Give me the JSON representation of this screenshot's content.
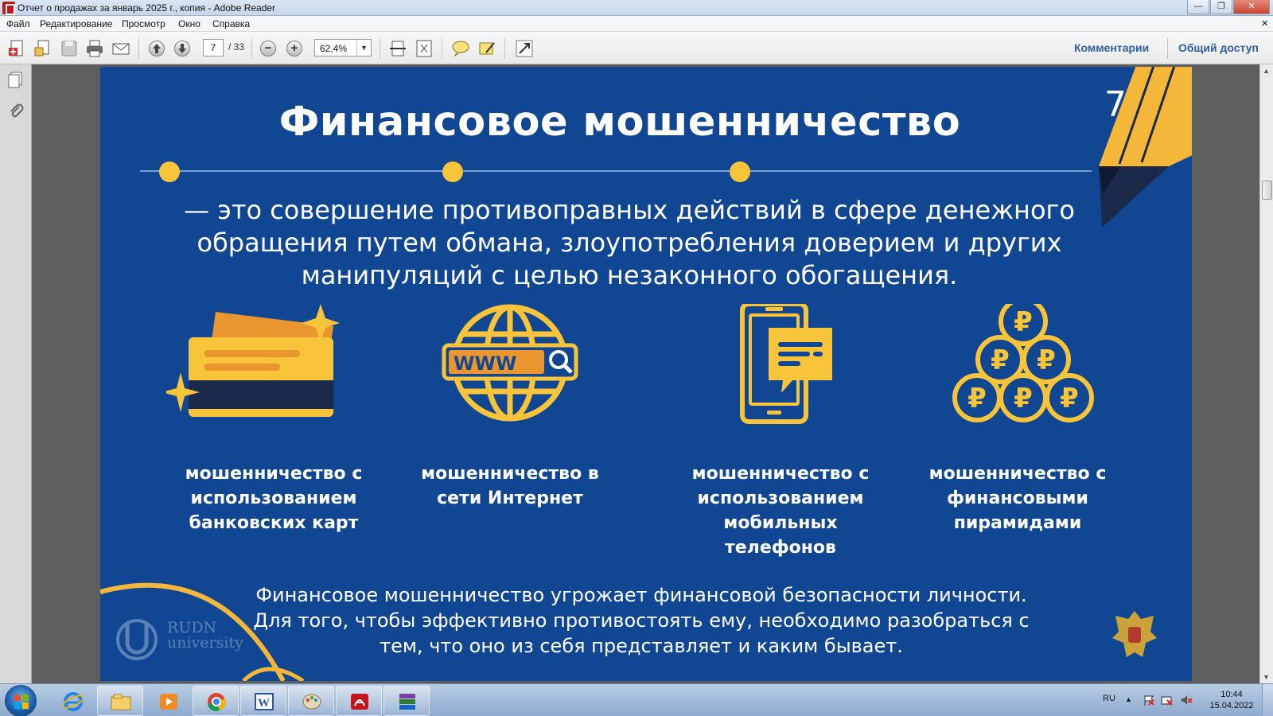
{
  "window": {
    "title": "Отчет о продажах за январь 2025 г., копия - Adobe Reader",
    "controls": {
      "minimize": "—",
      "maximize": "❐",
      "close": "✕"
    }
  },
  "menu": {
    "items": [
      "Файл",
      "Редактирование",
      "Просмотр",
      "Окно",
      "Справка"
    ],
    "doc_close": "×"
  },
  "toolbar": {
    "page_current": "7",
    "page_total": "/ 33",
    "zoom": "62,4%",
    "zoom_dropdown": "▼",
    "zoom_out": "−",
    "zoom_in": "+",
    "comments": "Комментарии",
    "share": "Общий доступ"
  },
  "slide": {
    "number": "7",
    "title": "Финансовое мошенничество",
    "definition": "—  это совершение противоправных действий в сфере денежного обращения путем обмана, злоупотребления доверием и других манипуляций с целью незаконного обогащения.",
    "items": [
      {
        "icon": "credit-cards-icon",
        "label": "мошенничество с использованием банковских карт"
      },
      {
        "icon": "globe-www-icon",
        "label": "мошенничество в сети Интернет",
        "www": "WWW"
      },
      {
        "icon": "mobile-phone-message-icon",
        "label": "мошенничество с использованием мобильных телефонов"
      },
      {
        "icon": "ruble-coins-pyramid-icon",
        "label": "мошенничество с финансовыми пирамидами",
        "coin_symbol": "₽"
      }
    ],
    "footer": "Финансовое мошенничество угрожает финансовой безопасности личности. Для того, чтобы эффективно противостоять ему, необходимо разобраться с тем, что оно из себя представляет и каким бывает.",
    "logo": {
      "line1": "RUDN",
      "line2": "university"
    }
  },
  "colors": {
    "slide_bg": "#114792",
    "accent_yellow": "#f7c43a",
    "accent_orange": "#e9962f",
    "dark_navy": "#1b2a4a",
    "link_blue": "#2e5f9e"
  },
  "taskbar": {
    "apps": [
      "internet-explorer-icon",
      "file-explorer-icon",
      "media-player-icon",
      "chrome-icon",
      "word-icon",
      "paint-icon",
      "adobe-reader-icon",
      "winrar-icon"
    ],
    "language": "RU",
    "tray_arrow": "▲",
    "time": "10:44",
    "date": "15.04.2022"
  }
}
